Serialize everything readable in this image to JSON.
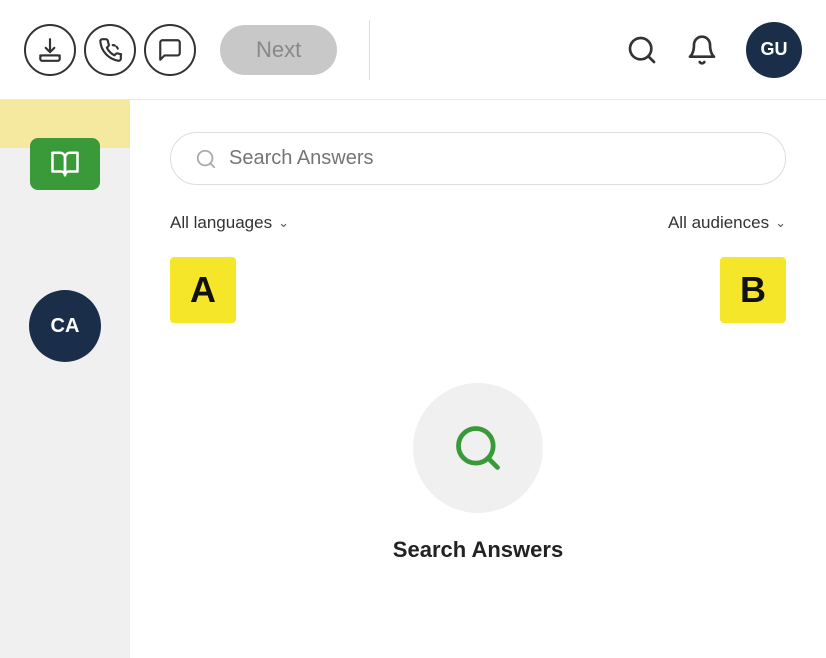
{
  "header": {
    "next_label": "Next",
    "avatar_initials": "GU",
    "icons": {
      "download": "download-icon",
      "phone": "phone-icon",
      "chat": "chat-icon",
      "search": "search-icon",
      "bell": "bell-icon"
    }
  },
  "sidebar": {
    "book_icon": "book-icon",
    "ca_label": "CA"
  },
  "filters": {
    "languages_label": "All languages",
    "audiences_label": "All audiences"
  },
  "search": {
    "placeholder": "Search Answers"
  },
  "labels": {
    "a": "A",
    "b": "B"
  },
  "empty_state": {
    "title": "Search Answers"
  },
  "colors": {
    "accent_green": "#3a9a3a",
    "navy": "#1a2e4a",
    "yellow": "#f5e62a",
    "light_yellow_bg": "#f5e9a0"
  }
}
